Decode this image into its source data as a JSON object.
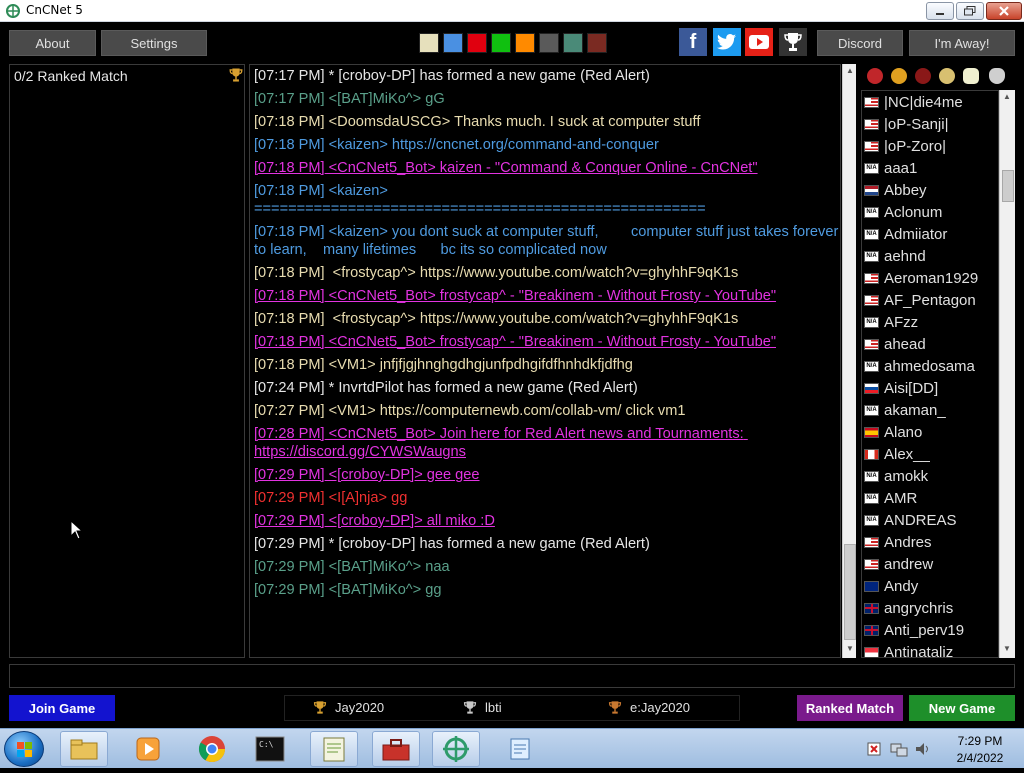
{
  "window": {
    "title": "CnCNet 5"
  },
  "topbar": {
    "about_label": "About",
    "settings_label": "Settings",
    "discord_label": "Discord",
    "away_label": "I'm Away!",
    "swatches": [
      "#e6e0bc",
      "#4a90e2",
      "#e0000f",
      "#10c010",
      "#ff8a00",
      "#5a5a5a",
      "#4a8a78",
      "#7a2a22"
    ]
  },
  "left_panel": {
    "title": "0/2 Ranked Match"
  },
  "chat": [
    {
      "time": "[07:17 PM]",
      "text": " * [croboy-DP] has formed a new game (Red Alert)",
      "color": "#e6e6e6",
      "underline": false
    },
    {
      "time": "[07:17 PM]",
      "text": " <[BAT]MiKo^> gG",
      "color": "#5aa08a",
      "underline": false
    },
    {
      "time": "[07:18 PM]",
      "text": " <DoomsdaUSCG> Thanks much. I suck at computer stuff",
      "color": "#e8dcb0",
      "underline": false
    },
    {
      "time": "[07:18 PM]",
      "text": " <kaizen> https://cncnet.org/command-and-conquer",
      "color": "#4f9be0",
      "underline": false
    },
    {
      "time": "[07:18 PM]",
      "text": " <CnCNet5_Bot> kaizen - \"Command & Conquer Online - CnCNet\"",
      "color": "#e233e0",
      "underline": true
    },
    {
      "time": "[07:18 PM]",
      "text": " <kaizen>\n=====================================================",
      "color": "#4f9be0",
      "underline": false
    },
    {
      "time": "[07:18 PM]",
      "text": " <kaizen> you dont suck at computer stuff,        computer stuff just takes forever to learn,    many lifetimes      bc its so complicated now",
      "color": "#4f9be0",
      "underline": false
    },
    {
      "time": "[07:18 PM]",
      "text": "  <frostycap^> https://www.youtube.com/watch?v=ghyhhF9qK1s",
      "color": "#e8dcb0",
      "underline": false
    },
    {
      "time": "[07:18 PM]",
      "text": " <CnCNet5_Bot> frostycap^ - \"Breakinem - Without Frosty - YouTube\"",
      "color": "#e233e0",
      "underline": true
    },
    {
      "time": "[07:18 PM]",
      "text": "  <frostycap^> https://www.youtube.com/watch?v=ghyhhF9qK1s",
      "color": "#e8dcb0",
      "underline": false
    },
    {
      "time": "[07:18 PM]",
      "text": " <CnCNet5_Bot> frostycap^ - \"Breakinem - Without Frosty - YouTube\"",
      "color": "#e233e0",
      "underline": true
    },
    {
      "time": "[07:18 PM]",
      "text": " <VM1> jnfjfjgjhnghgdhgjunfpdhgifdfhnhdkfjdfhg",
      "color": "#e8dcb0",
      "underline": false
    },
    {
      "time": "[07:24 PM]",
      "text": " * InvrtdPilot has formed a new game (Red Alert)",
      "color": "#e6e6e6",
      "underline": false
    },
    {
      "time": "[07:27 PM]",
      "text": " <VM1> https://computernewb.com/collab-vm/ click vm1",
      "color": "#e8dcb0",
      "underline": false
    },
    {
      "time": "[07:28 PM]",
      "text": " <CnCNet5_Bot> Join here for Red Alert news and Tournaments: https://discord.gg/CYWSWaugns",
      "color": "#e233e0",
      "underline": true
    },
    {
      "time": "[07:29 PM]",
      "text": " <[croboy-DP]> gee gee",
      "color": "#e233e0",
      "underline": true
    },
    {
      "time": "[07:29 PM]",
      "text": " <I[A]nja> gg",
      "color": "#f03030",
      "underline": false
    },
    {
      "time": "[07:29 PM]",
      "text": " <[croboy-DP]> all miko :D",
      "color": "#e233e0",
      "underline": true
    },
    {
      "time": "[07:29 PM]",
      "text": " * [croboy-DP] has formed a new game (Red Alert)",
      "color": "#e6e6e6",
      "underline": false
    },
    {
      "time": "[07:29 PM]",
      "text": " <[BAT]MiKo^> naa",
      "color": "#5aa08a",
      "underline": false
    },
    {
      "time": "[07:29 PM]",
      "text": " <[BAT]MiKo^> gg",
      "color": "#5aa08a",
      "underline": false
    }
  ],
  "users": [
    {
      "name": "|NC|die4me",
      "flag": "us"
    },
    {
      "name": "|oP-Sanji|",
      "flag": "us"
    },
    {
      "name": "|oP-Zoro|",
      "flag": "us"
    },
    {
      "name": "aaa1",
      "flag": "na"
    },
    {
      "name": "Abbey",
      "flag": "nl"
    },
    {
      "name": "Aclonum",
      "flag": "na"
    },
    {
      "name": "Admiiator",
      "flag": "na"
    },
    {
      "name": "aehnd",
      "flag": "na"
    },
    {
      "name": "Aeroman1929",
      "flag": "us"
    },
    {
      "name": "AF_Pentagon",
      "flag": "us"
    },
    {
      "name": "AFzz",
      "flag": "na"
    },
    {
      "name": "ahead",
      "flag": "us"
    },
    {
      "name": "ahmedosama",
      "flag": "na"
    },
    {
      "name": "Aisi[DD]",
      "flag": "sk"
    },
    {
      "name": "akaman_",
      "flag": "na"
    },
    {
      "name": "Alano",
      "flag": "es"
    },
    {
      "name": "Alex__",
      "flag": "ca"
    },
    {
      "name": "amokk",
      "flag": "na"
    },
    {
      "name": "AMR",
      "flag": "na"
    },
    {
      "name": "ANDREAS",
      "flag": "na"
    },
    {
      "name": "Andres",
      "flag": "us"
    },
    {
      "name": "andrew",
      "flag": "us"
    },
    {
      "name": "Andy",
      "flag": "au"
    },
    {
      "name": "angrychris",
      "flag": "gb"
    },
    {
      "name": "Anti_perv19",
      "flag": "gb"
    },
    {
      "name": "Antinataliz",
      "flag": "sg"
    }
  ],
  "flag_na_text": "N/A",
  "bottom": {
    "join_label": "Join Game",
    "ranked_match_label": "Ranked Match",
    "new_game_label": "New Game",
    "ranked_items": [
      "Jay2020",
      "lbti",
      "e:Jay2020"
    ]
  },
  "taskbar": {
    "time": "7:29 PM",
    "date": "2/4/2022"
  }
}
